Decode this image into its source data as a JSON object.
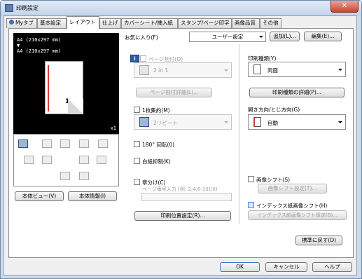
{
  "window": {
    "title": "印刷設定",
    "close_label": "✕"
  },
  "tabs": [
    "Myタブ",
    "基本設定",
    "レイアウト",
    "仕上げ",
    "カバーシート/挿入紙",
    "スタンプ/ページ印字",
    "画像品質",
    "その他"
  ],
  "preview": {
    "line1": "A4 (210x297 mm)",
    "arrow": "▼",
    "line2": "A4 (210x297 mm)",
    "zoom": "x1",
    "page_number": "1"
  },
  "left_buttons": {
    "view": "本体ビュー(V)",
    "info": "本体情報(I)"
  },
  "favorite": {
    "label": "お気に入り(F)",
    "value": "ユーザー設定",
    "add": "追加(L)...",
    "edit": "編集(E)..."
  },
  "combination": {
    "label": "ページ割付(O)",
    "value": "2 in 1",
    "details": "ページ割付詳細(L)..."
  },
  "poster": {
    "label": "1枚集約(M)",
    "value": "2リピート"
  },
  "rotate": {
    "label": "180° 回転(0)"
  },
  "skip_blank": {
    "label": "白紙抑制(K)"
  },
  "chapter": {
    "label": "章分け(C)",
    "hint": "ページ番号入力 [例: 2,4,6-10](X)"
  },
  "print_position": {
    "button": "印刷位置設定(R)..."
  },
  "print_type": {
    "label": "印刷種類(Y)",
    "value": "両面",
    "details": "印刷種類の詳細(P)..."
  },
  "binding": {
    "label": "開き方向/とじ方向(G)",
    "value": "自動"
  },
  "image_shift": {
    "label": "画像シフト(S)",
    "button": "画像シフト設定(T)..."
  },
  "index_shift": {
    "label": "インデックス紙画像シフト(H)",
    "button": "インデックス紙画像シフト設定(B)..."
  },
  "footer": {
    "default": "標準に戻す(D)",
    "ok": "OK",
    "cancel": "キャンセル",
    "help": "ヘルプ"
  },
  "colors": {
    "accent": "#2d5ea8",
    "red_mark": "#d83a3a"
  }
}
